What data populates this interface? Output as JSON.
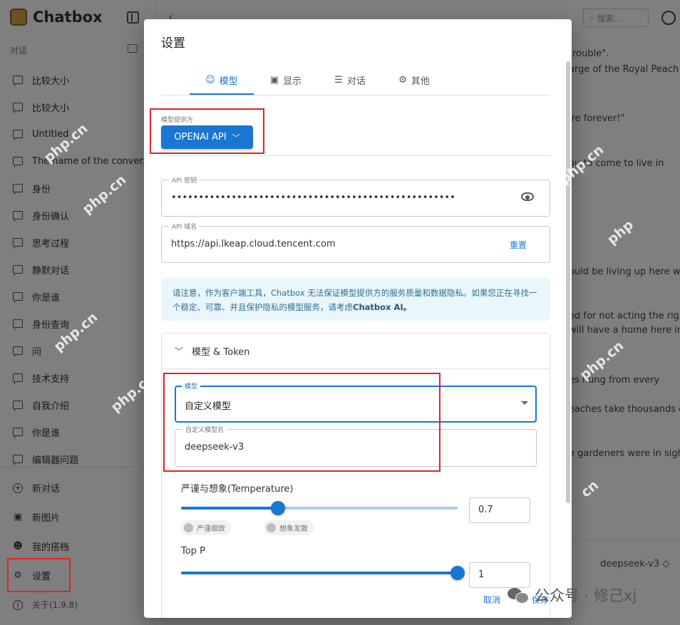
{
  "app": {
    "name": "Chatbox",
    "section_label": "对话",
    "conversations": [
      "比较大小",
      "比较大小",
      "Untitled",
      "The name of the conver...",
      "身份",
      "身份确认",
      "思考过程",
      "静默对话",
      "你是谁",
      "身份查询",
      "问",
      "技术支持",
      "自我介绍",
      "你是谁",
      "编辑器问题"
    ],
    "bottom_items": {
      "new_chat": "新对话",
      "new_image": "新图片",
      "my_partners": "我的搭档",
      "settings": "设置",
      "about": "关于(1.9.8)"
    },
    "search_placeholder": "搜索...",
    "chat_lines": [
      "trouble\".",
      "arge of the Royal Peach",
      "'re forever!\"",
      "ou to come to live in",
      "ould be living up here wit",
      "ed for not acting the right",
      "will have a home here in",
      "es hung from every",
      "eaches take thousands of",
      "e gardeners were in sigh"
    ],
    "model_selector": "deepseek-v3 ◇"
  },
  "dialog": {
    "title": "设置",
    "tabs": [
      {
        "label": "模型",
        "icon": "robot-icon",
        "glyph": "☺"
      },
      {
        "label": "显示",
        "icon": "display-icon",
        "glyph": "▣"
      },
      {
        "label": "对话",
        "icon": "chat-icon",
        "glyph": "☰"
      },
      {
        "label": "其他",
        "icon": "gear-icon",
        "glyph": "⚙"
      }
    ],
    "provider": {
      "label": "模型提供方",
      "value": "OPENAI API"
    },
    "api_key": {
      "label": "API 密钥",
      "value": "••••••••••••••••••••••••••••••••••••••••••••••••••••"
    },
    "api_host": {
      "label": "API 域名",
      "value": "https://api.lkeap.cloud.tencent.com",
      "reset": "重置"
    },
    "notice": {
      "text": "请注意，作为客户端工具，Chatbox 无法保证模型提供方的服务质量和数据隐私。如果您正在寻找一个稳定、可靠、并且保护隐私的模型服务，请考虑",
      "link": "Chatbox AI。"
    },
    "accordion_title": "模型 & Token",
    "model_select": {
      "label": "模型",
      "value": "自定义模型"
    },
    "custom_model": {
      "label": "自定义模型名",
      "value": "deepseek-v3"
    },
    "temperature": {
      "label": "严谨与想象(Temperature)",
      "value": "0.7",
      "fraction": 0.35,
      "chip_left": "严谨细致",
      "chip_right": "想象发散"
    },
    "top_p": {
      "label": "Top P",
      "value": "1",
      "fraction": 1.0
    },
    "cancel": "取消",
    "save": "保存"
  },
  "watermarks": {
    "site": "php.cn",
    "site_short": "php",
    "site_cn": "cn",
    "signature": "公众号 · 修己xj"
  },
  "colors": {
    "accent": "#1976d2",
    "highlight": "#e02424",
    "notice_bg": "#e9f6fc"
  }
}
